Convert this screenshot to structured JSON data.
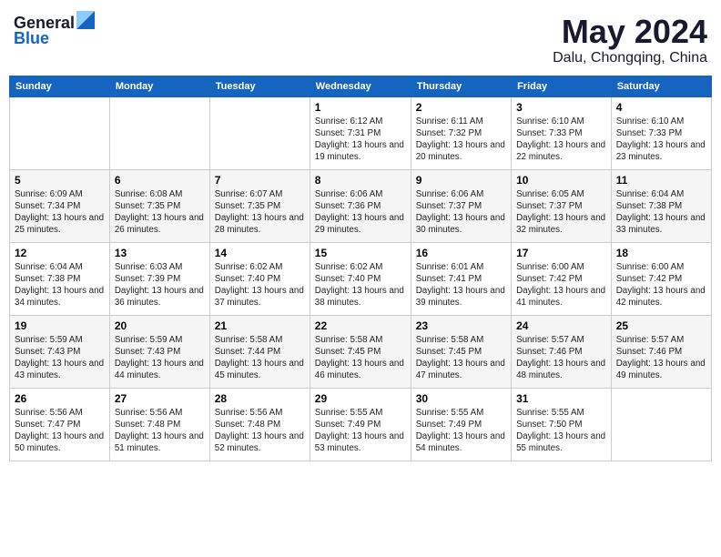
{
  "header": {
    "logo_line1": "General",
    "logo_line2": "Blue",
    "month": "May 2024",
    "location": "Dalu, Chongqing, China"
  },
  "weekdays": [
    "Sunday",
    "Monday",
    "Tuesday",
    "Wednesday",
    "Thursday",
    "Friday",
    "Saturday"
  ],
  "weeks": [
    [
      {
        "day": "",
        "content": ""
      },
      {
        "day": "",
        "content": ""
      },
      {
        "day": "",
        "content": ""
      },
      {
        "day": "1",
        "content": "Sunrise: 6:12 AM\nSunset: 7:31 PM\nDaylight: 13 hours and 19 minutes."
      },
      {
        "day": "2",
        "content": "Sunrise: 6:11 AM\nSunset: 7:32 PM\nDaylight: 13 hours and 20 minutes."
      },
      {
        "day": "3",
        "content": "Sunrise: 6:10 AM\nSunset: 7:33 PM\nDaylight: 13 hours and 22 minutes."
      },
      {
        "day": "4",
        "content": "Sunrise: 6:10 AM\nSunset: 7:33 PM\nDaylight: 13 hours and 23 minutes."
      }
    ],
    [
      {
        "day": "5",
        "content": "Sunrise: 6:09 AM\nSunset: 7:34 PM\nDaylight: 13 hours and 25 minutes."
      },
      {
        "day": "6",
        "content": "Sunrise: 6:08 AM\nSunset: 7:35 PM\nDaylight: 13 hours and 26 minutes."
      },
      {
        "day": "7",
        "content": "Sunrise: 6:07 AM\nSunset: 7:35 PM\nDaylight: 13 hours and 28 minutes."
      },
      {
        "day": "8",
        "content": "Sunrise: 6:06 AM\nSunset: 7:36 PM\nDaylight: 13 hours and 29 minutes."
      },
      {
        "day": "9",
        "content": "Sunrise: 6:06 AM\nSunset: 7:37 PM\nDaylight: 13 hours and 30 minutes."
      },
      {
        "day": "10",
        "content": "Sunrise: 6:05 AM\nSunset: 7:37 PM\nDaylight: 13 hours and 32 minutes."
      },
      {
        "day": "11",
        "content": "Sunrise: 6:04 AM\nSunset: 7:38 PM\nDaylight: 13 hours and 33 minutes."
      }
    ],
    [
      {
        "day": "12",
        "content": "Sunrise: 6:04 AM\nSunset: 7:38 PM\nDaylight: 13 hours and 34 minutes."
      },
      {
        "day": "13",
        "content": "Sunrise: 6:03 AM\nSunset: 7:39 PM\nDaylight: 13 hours and 36 minutes."
      },
      {
        "day": "14",
        "content": "Sunrise: 6:02 AM\nSunset: 7:40 PM\nDaylight: 13 hours and 37 minutes."
      },
      {
        "day": "15",
        "content": "Sunrise: 6:02 AM\nSunset: 7:40 PM\nDaylight: 13 hours and 38 minutes."
      },
      {
        "day": "16",
        "content": "Sunrise: 6:01 AM\nSunset: 7:41 PM\nDaylight: 13 hours and 39 minutes."
      },
      {
        "day": "17",
        "content": "Sunrise: 6:00 AM\nSunset: 7:42 PM\nDaylight: 13 hours and 41 minutes."
      },
      {
        "day": "18",
        "content": "Sunrise: 6:00 AM\nSunset: 7:42 PM\nDaylight: 13 hours and 42 minutes."
      }
    ],
    [
      {
        "day": "19",
        "content": "Sunrise: 5:59 AM\nSunset: 7:43 PM\nDaylight: 13 hours and 43 minutes."
      },
      {
        "day": "20",
        "content": "Sunrise: 5:59 AM\nSunset: 7:43 PM\nDaylight: 13 hours and 44 minutes."
      },
      {
        "day": "21",
        "content": "Sunrise: 5:58 AM\nSunset: 7:44 PM\nDaylight: 13 hours and 45 minutes."
      },
      {
        "day": "22",
        "content": "Sunrise: 5:58 AM\nSunset: 7:45 PM\nDaylight: 13 hours and 46 minutes."
      },
      {
        "day": "23",
        "content": "Sunrise: 5:58 AM\nSunset: 7:45 PM\nDaylight: 13 hours and 47 minutes."
      },
      {
        "day": "24",
        "content": "Sunrise: 5:57 AM\nSunset: 7:46 PM\nDaylight: 13 hours and 48 minutes."
      },
      {
        "day": "25",
        "content": "Sunrise: 5:57 AM\nSunset: 7:46 PM\nDaylight: 13 hours and 49 minutes."
      }
    ],
    [
      {
        "day": "26",
        "content": "Sunrise: 5:56 AM\nSunset: 7:47 PM\nDaylight: 13 hours and 50 minutes."
      },
      {
        "day": "27",
        "content": "Sunrise: 5:56 AM\nSunset: 7:48 PM\nDaylight: 13 hours and 51 minutes."
      },
      {
        "day": "28",
        "content": "Sunrise: 5:56 AM\nSunset: 7:48 PM\nDaylight: 13 hours and 52 minutes."
      },
      {
        "day": "29",
        "content": "Sunrise: 5:55 AM\nSunset: 7:49 PM\nDaylight: 13 hours and 53 minutes."
      },
      {
        "day": "30",
        "content": "Sunrise: 5:55 AM\nSunset: 7:49 PM\nDaylight: 13 hours and 54 minutes."
      },
      {
        "day": "31",
        "content": "Sunrise: 5:55 AM\nSunset: 7:50 PM\nDaylight: 13 hours and 55 minutes."
      },
      {
        "day": "",
        "content": ""
      }
    ]
  ]
}
